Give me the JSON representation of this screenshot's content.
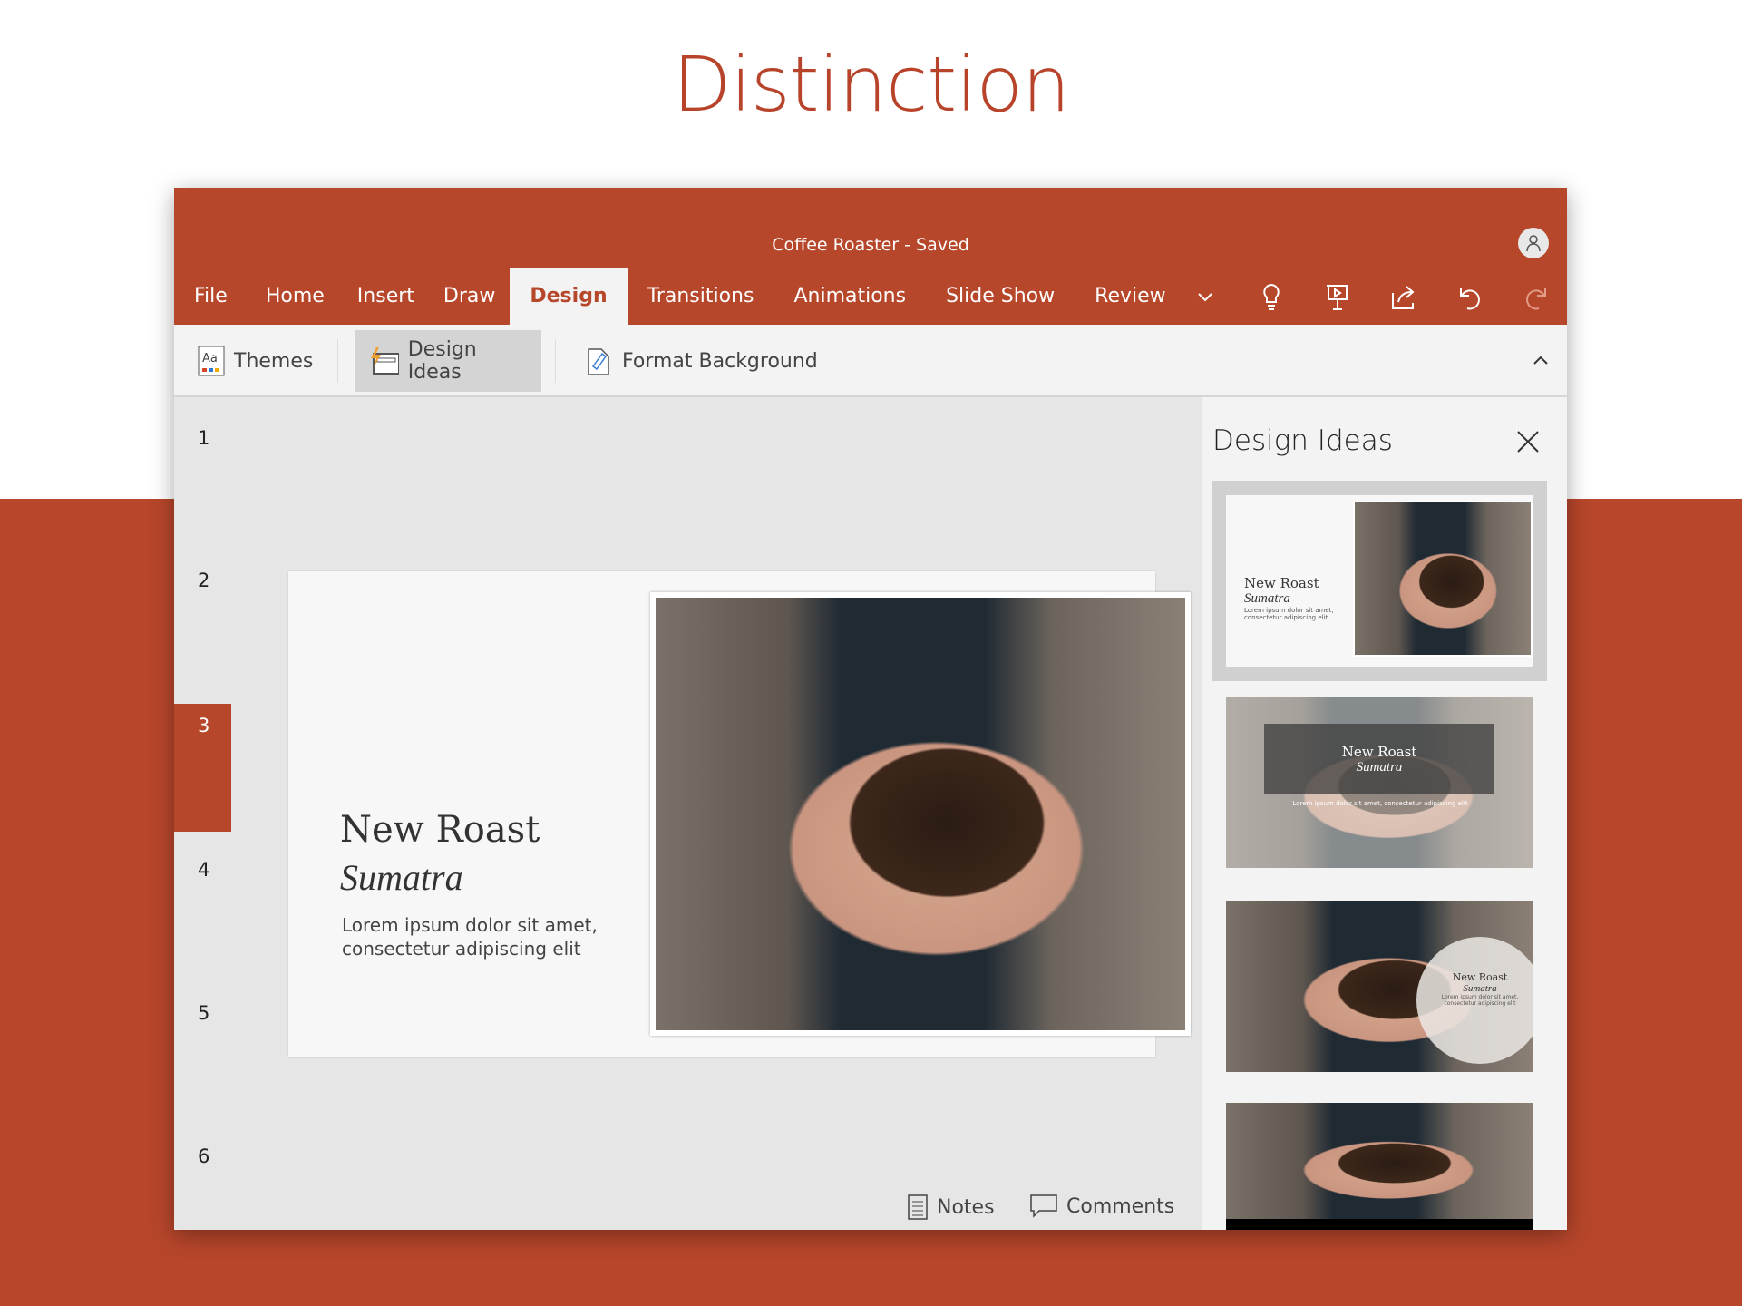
{
  "headline": "Distinction",
  "window": {
    "doc_title": "Coffee Roaster - Saved"
  },
  "tabs": [
    "File",
    "Home",
    "Insert",
    "Draw",
    "Design",
    "Transitions",
    "Animations",
    "Slide Show",
    "Review"
  ],
  "active_tab": "Design",
  "ribbon": {
    "themes": "Themes",
    "design_ideas": "Design Ideas",
    "format_background": "Format Background"
  },
  "slides": {
    "numbers": [
      "1",
      "2",
      "3",
      "4",
      "5",
      "6"
    ],
    "selected": "3"
  },
  "slide": {
    "title": "New Roast",
    "subtitle": "Sumatra",
    "body": "Lorem ipsum dolor sit amet, consectetur adipiscing elit"
  },
  "footer": {
    "notes": "Notes",
    "comments": "Comments"
  },
  "panel": {
    "title": "Design Ideas"
  },
  "colors": {
    "accent": "#b7472a"
  }
}
